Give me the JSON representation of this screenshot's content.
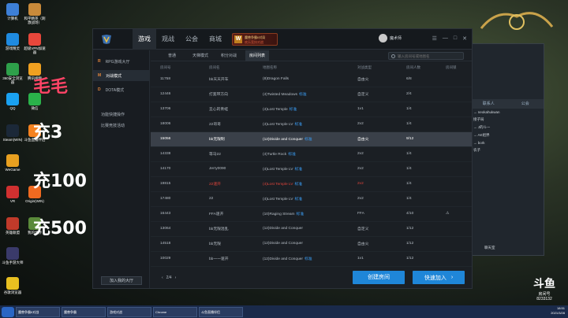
{
  "desktop": {
    "icons": [
      {
        "label": "计算机"
      },
      {
        "label": "和平精英（刺激战场）"
      },
      {
        "label": "游戏精灵"
      },
      {
        "label": "超级VPN加速器"
      },
      {
        "label": "360安全浏览器"
      },
      {
        "label": "腾讯视频"
      },
      {
        "label": "QQ"
      },
      {
        "label": "微信"
      },
      {
        "label": "Steam(WIN)"
      },
      {
        "label": "斗鱼直播伴侣"
      },
      {
        "label": "WeGame"
      },
      {
        "label": "VR"
      },
      {
        "label": "Origin(WIN)"
      },
      {
        "label": "英雄联盟"
      },
      {
        "label": "我的世界"
      },
      {
        "label": "斗鱼手游大师"
      },
      {
        "label": "谷歌浏览器"
      }
    ],
    "promo": [
      "毛毛",
      "充3",
      "充100",
      "充500"
    ]
  },
  "launcher": {
    "nav": [
      "游戏",
      "观战",
      "公会",
      "商城"
    ],
    "banner": {
      "logo": "W",
      "line1": "魔兽争霸II对局",
      "line2": "欢乐竞技对战"
    },
    "username": "魔术师",
    "window_buttons": [
      "☰",
      "—",
      "□",
      "✕"
    ],
    "sidebar": [
      {
        "icon": "R",
        "label": "RPG游戏大厅"
      },
      {
        "icon": "M",
        "label": "对战模式"
      },
      {
        "icon": "D",
        "label": "DOTA模式"
      },
      {
        "label": "功能快捷操作"
      },
      {
        "label": "比赛竞技活动"
      }
    ],
    "sidebar_button": "加入我的大厅",
    "subtabs": [
      "普通",
      "天梯模式",
      "积分对战",
      "房间列表"
    ],
    "search_placeholder": "输入房间号或地图名",
    "columns": [
      "房间号",
      "房间名",
      "地图名称",
      "对战类型",
      "房间人数",
      "房间锁"
    ],
    "rows": [
      {
        "id": "11758",
        "name": "bb天天开车",
        "map": "(8)Dragon Falls",
        "tag": "",
        "type": "自由火",
        "count": "6/8",
        "lock": ""
      },
      {
        "id": "12446",
        "name": "打宽带方向",
        "map": "(4)Twisted Meadows",
        "tag": "标准",
        "type": "自定义",
        "count": "2/4",
        "lock": ""
      },
      {
        "id": "13706",
        "name": "丑心的青蛙",
        "map": "(4)Lost Temple",
        "tag": "标准",
        "type": "1v1",
        "count": "1/4",
        "lock": ""
      },
      {
        "id": "18006",
        "name": "22哥哥",
        "map": "(4)Lost Temple LV",
        "tag": "标准",
        "type": "2v2",
        "count": "1/4",
        "lock": ""
      },
      {
        "id": "15056",
        "name": "bb无限制",
        "map": "(12)Divide and Conquer",
        "tag": "标准",
        "type": "自由火",
        "count": "9/12",
        "lock": ""
      },
      {
        "id": "14338",
        "name": "等马22",
        "map": "(4)Turtle Rock",
        "tag": "标准",
        "type": "2v2",
        "count": "1/4",
        "lock": ""
      },
      {
        "id": "14170",
        "name": "Jerry0090",
        "map": "(4)Lost Temple LV",
        "tag": "标准",
        "type": "2v2",
        "count": "1/4",
        "lock": ""
      },
      {
        "id": "19815",
        "name": "22速开",
        "map": "(4)Lost Temple LV",
        "tag": "标准",
        "type": "2v2",
        "count": "1/4",
        "lock": ""
      },
      {
        "id": "17480",
        "name": "22",
        "map": "(4)Lost Temple LV",
        "tag": "标准",
        "type": "2v2",
        "count": "1/4",
        "lock": ""
      },
      {
        "id": "16443",
        "name": "FFA速开",
        "map": "(10)Raging Stream",
        "tag": "标准",
        "type": "FFA",
        "count": "4/10",
        "lock": "⚠"
      },
      {
        "id": "13064",
        "name": "bb无限混乱",
        "map": "(12)Divide and Conquer",
        "tag": "",
        "type": "自定义",
        "count": "1/12",
        "lock": ""
      },
      {
        "id": "14518",
        "name": "bb无限",
        "map": "(12)Divide and Conquer",
        "tag": "",
        "type": "自由火",
        "count": "1/12",
        "lock": ""
      },
      {
        "id": "10029",
        "name": "bb一一速开",
        "map": "(12)Divide and Conquer",
        "tag": "标准",
        "type": "1v1",
        "count": "1/12",
        "lock": ""
      }
    ],
    "pager": {
      "prev": "‹",
      "page": "2/4",
      "next": "›"
    },
    "create_button": "创建房间",
    "join_button": "快速加入",
    "join_arrow": "›"
  },
  "chat": {
    "tabs": [
      "联系人",
      "公会"
    ],
    "lines": [
      "→ neokahukwan",
      "接子局",
      "→ J的ルー",
      "→ AK组界",
      "→ bork",
      "农子"
    ],
    "footer": "聊天室"
  },
  "taskbar": {
    "tasks": [
      "魔兽争霸II对战",
      "魔兽争霸",
      "游戏对战",
      "Chrome",
      "斗鱼直播伴侣"
    ],
    "time": "18:51",
    "date": "2021/3/28"
  },
  "watermark": {
    "brand": "斗鱼",
    "sub": "房间号",
    "room": "8233132"
  }
}
